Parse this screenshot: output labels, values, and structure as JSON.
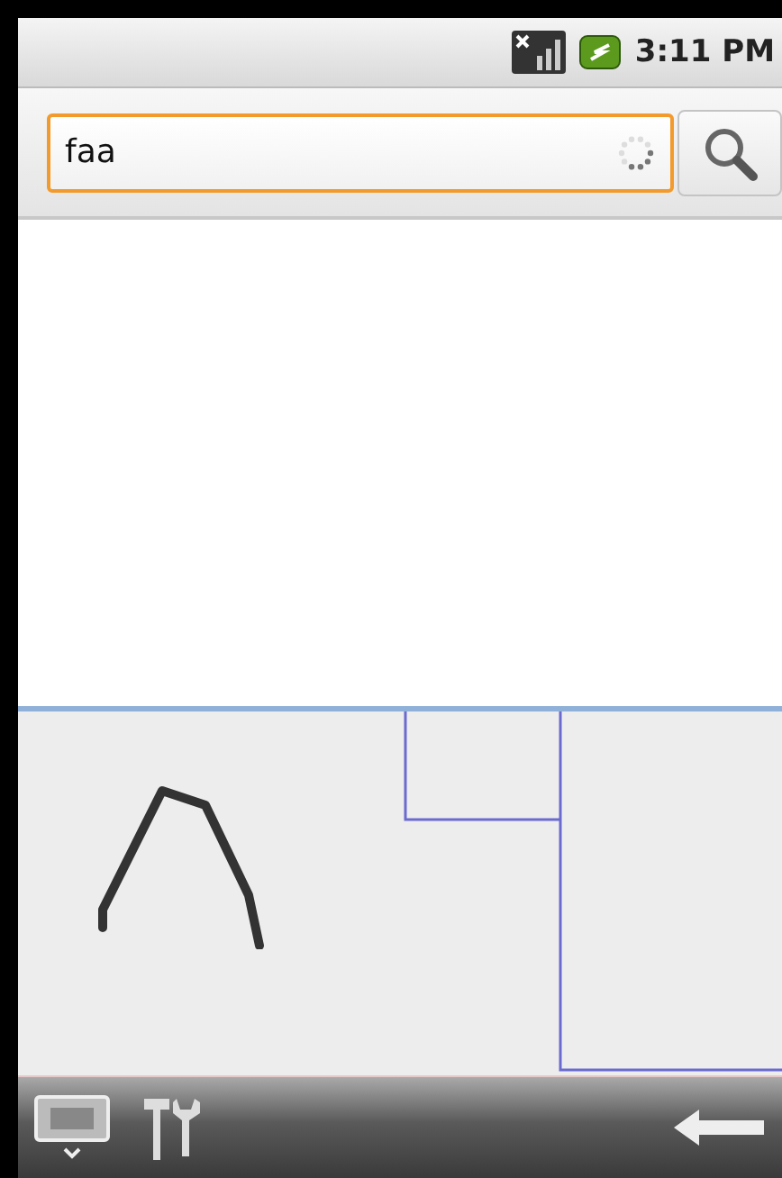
{
  "status_bar": {
    "time": "3:11 PM"
  },
  "search": {
    "value": "faa"
  }
}
